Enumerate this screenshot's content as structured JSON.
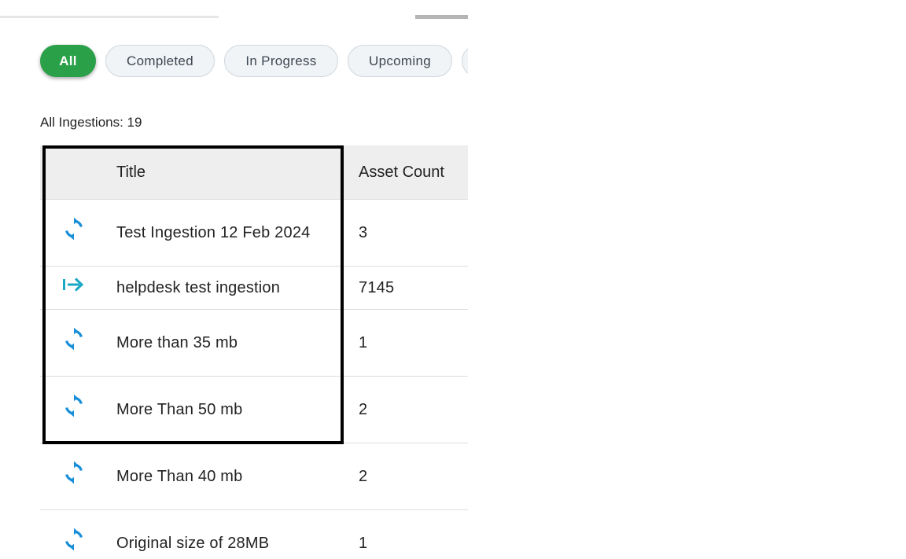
{
  "filters": [
    {
      "label": "All",
      "active": true
    },
    {
      "label": "Completed",
      "active": false
    },
    {
      "label": "In Progress",
      "active": false
    },
    {
      "label": "Upcoming",
      "active": false
    },
    {
      "label": "",
      "active": false
    }
  ],
  "summary": {
    "label": "All Ingestions: 19"
  },
  "table": {
    "columns": {
      "title": "Title",
      "asset_count": "Asset Count"
    },
    "rows": [
      {
        "icon": "sync-icon",
        "title": "Test Ingestion 12 Feb 2024",
        "asset_count": "3"
      },
      {
        "icon": "arrow-to-right-icon",
        "title": "helpdesk test ingestion",
        "asset_count": "7145"
      },
      {
        "icon": "sync-icon",
        "title": "More than 35 mb",
        "asset_count": "1"
      },
      {
        "icon": "sync-icon",
        "title": "More Than 50 mb",
        "asset_count": "2"
      },
      {
        "icon": "sync-icon",
        "title": "More Than 40 mb",
        "asset_count": "2"
      },
      {
        "icon": "sync-icon",
        "title": "Original size of 28MB",
        "asset_count": "1"
      }
    ]
  },
  "colors": {
    "accent_green": "#2aa149",
    "sync_blue": "#1a8fd9",
    "arrow_teal": "#19a7c4"
  }
}
